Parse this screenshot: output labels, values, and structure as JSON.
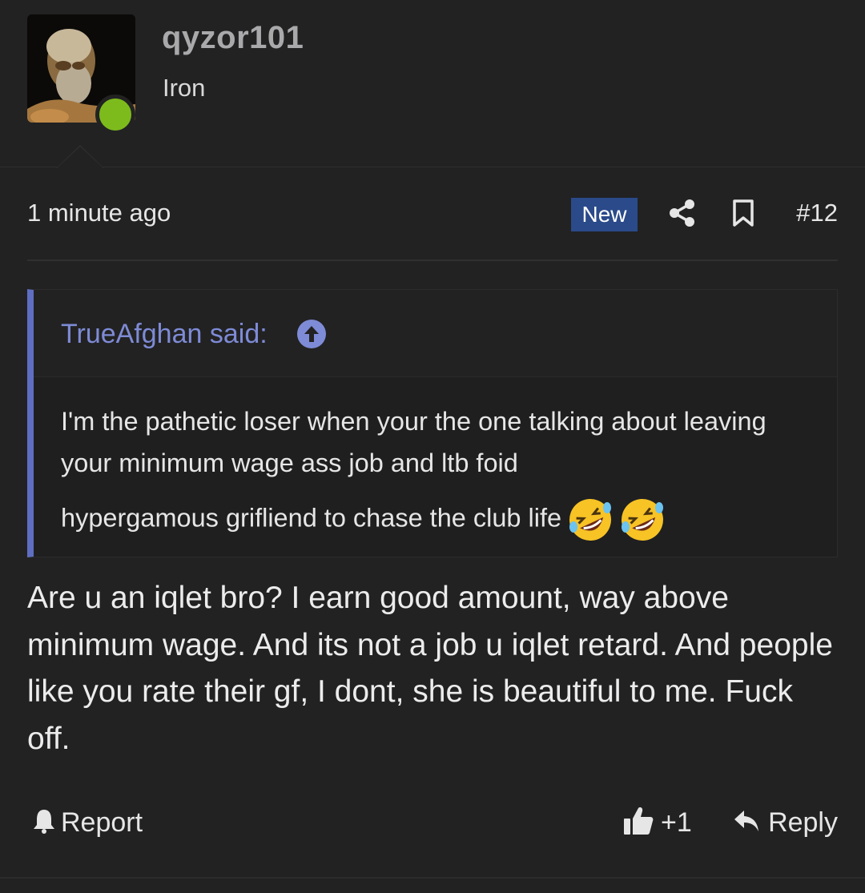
{
  "user": {
    "username": "qyzor101",
    "rank": "Iron",
    "online_status_color": "#7dbb1c",
    "avatar_icon": "bearded-man-portrait"
  },
  "post": {
    "timestamp": "1 minute ago",
    "new_badge": "New",
    "share_icon": "share-icon",
    "bookmark_icon": "bookmark-icon",
    "number": "#12"
  },
  "quote": {
    "author_label": "TrueAfghan said:",
    "jump_icon": "arrow-up-circle-icon",
    "body": "I'm the pathetic loser when your the one talking about leaving your minimum wage ass job and ltb foid",
    "last_line": "hypergamous grifliend to chase the club life",
    "emoji": "rolling-on-floor-laughing"
  },
  "message": {
    "text": "Are u an iqlet bro? I earn good amount, way above minimum wage. And its not a job u iqlet retard. And people like you rate their gf, I dont, she is beautiful to me. Fuck off."
  },
  "actions": {
    "report_label": "Report",
    "like_count": "+1",
    "reply_label": "Reply"
  },
  "colors": {
    "background": "#222223",
    "accent_quote": "#5f6ec2",
    "quote_author": "#7e8bd6",
    "new_badge": "#2a4a8a"
  }
}
